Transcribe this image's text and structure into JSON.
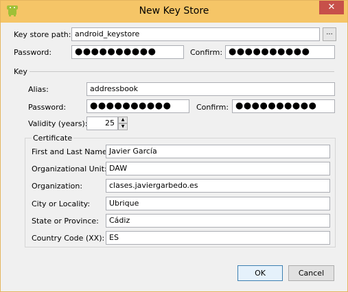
{
  "window": {
    "title": "New Key Store",
    "close_glyph": "✕"
  },
  "keystore": {
    "path_label": "Key store path:",
    "path_value": "android_keystore",
    "browse_label": "...",
    "password_label": "Password:",
    "password_value": "●●●●●●●●●●",
    "confirm_label": "Confirm:",
    "confirm_value": "●●●●●●●●●●"
  },
  "key": {
    "section_label": "Key",
    "alias_label": "Alias:",
    "alias_value": "addressbook",
    "password_label": "Password:",
    "password_value": "●●●●●●●●●●",
    "confirm_label": "Confirm:",
    "confirm_value": "●●●●●●●●●●",
    "validity_label": "Validity (years):",
    "validity_value": "25"
  },
  "certificate": {
    "group_label": "Certificate",
    "fields": [
      {
        "label": "First and Last Name:",
        "value": "Javier García"
      },
      {
        "label": "Organizational Unit:",
        "value": "DAW"
      },
      {
        "label": "Organization:",
        "value": "clases.javiergarbedo.es"
      },
      {
        "label": "City or Locality:",
        "value": "Ubrique"
      },
      {
        "label": "State or Province:",
        "value": "Cádiz"
      },
      {
        "label": "Country Code (XX):",
        "value": "ES"
      }
    ]
  },
  "buttons": {
    "ok": "OK",
    "cancel": "Cancel"
  },
  "icons": {
    "app": "android-icon",
    "spin_up": "▲",
    "spin_down": "▼"
  },
  "colors": {
    "titlebar": "#f5c567",
    "close": "#c7504a",
    "android": "#9fc037"
  }
}
